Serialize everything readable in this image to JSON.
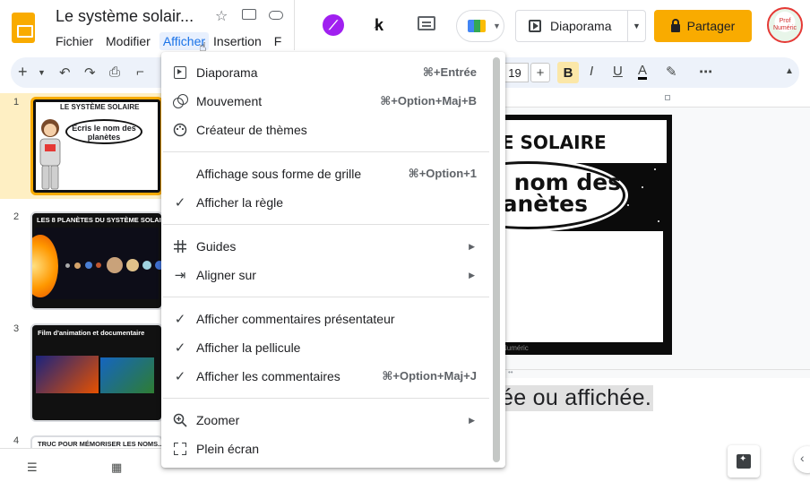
{
  "header": {
    "doc_title": "Le système solair...",
    "menus": [
      "Fichier",
      "Modifier",
      "Afficher",
      "Insertion",
      "F"
    ],
    "active_menu": "Afficher",
    "k_label": "k",
    "slideshow_label": "Diaporama",
    "share_label": "Partager",
    "avatar_text": "Prof Numéric"
  },
  "toolbar": {
    "font_size": "19",
    "bold": "B",
    "italic": "I",
    "underline": "U",
    "text_color": "A",
    "more": "⋯"
  },
  "filmstrip": {
    "slides": [
      {
        "num": "1",
        "title": "LE SYSTÈME SOLAIRE",
        "subtitle": "Écris le nom des planètes"
      },
      {
        "num": "2",
        "title": "LES 8 PLANÈTES DU SYSTÈME SOLAIRE"
      },
      {
        "num": "3",
        "title": "Film d'animation et documentaire"
      },
      {
        "num": "4",
        "title": "TRUC POUR MÉMORISER LES NOMS..."
      }
    ]
  },
  "canvas": {
    "title": "ME SOLAIRE",
    "bubble_line1": "e nom des",
    "bubble_line2": "lanètes",
    "footer": "Numéric"
  },
  "notes": {
    "text": "chée ou affichée."
  },
  "menu": {
    "items": [
      {
        "label": "Diaporama",
        "shortcut": "⌘+Entrée",
        "icon": "slideshow-icon"
      },
      {
        "label": "Mouvement",
        "shortcut": "⌘+Option+Maj+B",
        "icon": "motion-icon"
      },
      {
        "label": "Créateur de thèmes",
        "shortcut": "",
        "icon": "palette-icon"
      },
      {
        "label": "Affichage sous forme de grille",
        "shortcut": "⌘+Option+1",
        "icon": ""
      },
      {
        "label": "Afficher la règle",
        "shortcut": "",
        "icon": "check-icon"
      },
      {
        "label": "Guides",
        "shortcut": "",
        "icon": "grid-icon"
      },
      {
        "label": "Aligner sur",
        "shortcut": "",
        "icon": "snap-icon"
      },
      {
        "label": "Afficher commentaires présentateur",
        "shortcut": "",
        "icon": "check-icon"
      },
      {
        "label": "Afficher la pellicule",
        "shortcut": "",
        "icon": "check-icon"
      },
      {
        "label": "Afficher les commentaires",
        "shortcut": "⌘+Option+Maj+J",
        "icon": "check-icon"
      },
      {
        "label": "Zoomer",
        "shortcut": "",
        "icon": "zoom-icon"
      },
      {
        "label": "Plein écran",
        "shortcut": "",
        "icon": "fullscreen-icon"
      }
    ]
  },
  "colors": {
    "accent": "#f9ab00",
    "active_menu_bg": "#e8f0fe",
    "toolbar_bg": "#edf2fa"
  }
}
